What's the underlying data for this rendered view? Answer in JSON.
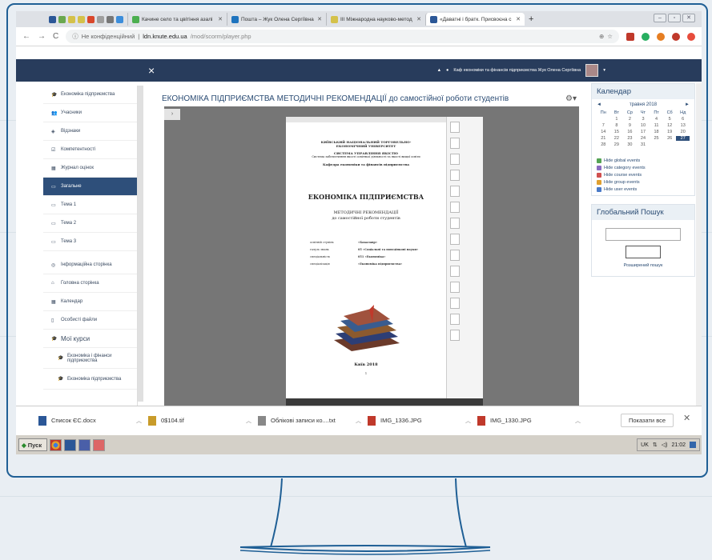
{
  "browser": {
    "tabs": [
      {
        "label": "Качине село та цвітіння азалі",
        "icon": "leaf-icon"
      },
      {
        "label": "Пошта – Жук Олена Сергіївна",
        "icon": "mail-icon"
      },
      {
        "label": "III Міжнародна науково-метод",
        "icon": "conference-icon"
      },
      {
        "label": "«Даватні і братк. Присвоєна с",
        "icon": "doc-icon"
      }
    ],
    "new_tab": "+",
    "address": {
      "secure_label": "Не конфіденційний",
      "host": "ldn.knute.edu.ua",
      "path": "/mod/scorm/player.php"
    }
  },
  "moodle": {
    "close": "×",
    "user_name": "Каф економіки та фінансів підприємства Жук Олена Сергіївна",
    "sidebar": [
      {
        "label": "Економіка підприємства",
        "icon": "cap-icon"
      },
      {
        "label": "Учасники",
        "icon": "users-icon"
      },
      {
        "label": "Відзнаки",
        "icon": "badge-icon"
      },
      {
        "label": "Компетентності",
        "icon": "check-icon"
      },
      {
        "label": "Журнал оцінок",
        "icon": "table-icon"
      },
      {
        "label": "Загальне",
        "icon": "folder-icon",
        "active": true
      },
      {
        "label": "Тема 1",
        "icon": "folder-icon"
      },
      {
        "label": "Тема 2",
        "icon": "folder-icon"
      },
      {
        "label": "Тема 3",
        "icon": "folder-icon"
      }
    ],
    "sidebar2": [
      {
        "label": "Інформаційна сторінка",
        "icon": "dashboard-icon"
      },
      {
        "label": "Головна сторінка",
        "icon": "home-icon"
      },
      {
        "label": "Календар",
        "icon": "calendar-icon"
      },
      {
        "label": "Особисті файли",
        "icon": "file-icon"
      },
      {
        "label": "Мої курси",
        "icon": "cap-icon",
        "big": true
      },
      {
        "label": "Економіка і фінанси підприємства",
        "icon": "cap-icon",
        "sub": true
      },
      {
        "label": "Економіка підприємства",
        "icon": "cap-icon",
        "sub": true
      }
    ],
    "content_title": "ЕКОНОМІКА ПІДПРИЄМСТВА МЕТОДИЧНІ РЕКОМЕНДАЦІЇ до самостійної роботи студентів",
    "toggle": "›"
  },
  "document": {
    "institution": "КИЇВСЬКИЙ НАЦІОНАЛЬНИЙ ТОРГОВЕЛЬНО-ЕКОНОМІЧНИЙ УНІВЕРСИТЕТ",
    "system": "СИСТЕМА УПРАВЛІННЯ ЯКІСТЮ",
    "system_sub": "Система забезпечення якості освітньої діяльності та якості вищої освіти",
    "department": "Кафедра економіки та фінансів підприємства",
    "title": "ЕКОНОМІКА ПІДПРИЄМСТВА",
    "subtitle1": "МЕТОДИЧНІ РЕКОМЕНДАЦІЇ",
    "subtitle2": "до самостійної роботи студентів",
    "meta": [
      {
        "k": "освітній ступінь",
        "v": "«Бакалавр»"
      },
      {
        "k": "галузь знань",
        "v": "05 «Соціальні та поведінкові науки»"
      },
      {
        "k": "спеціальність",
        "v": "051 «Економіка»"
      },
      {
        "k": "спеціалізація",
        "v": "«Економіка підприємства»"
      }
    ],
    "city_year": "Київ 2018",
    "page_num": "1"
  },
  "calendar": {
    "title": "Календар",
    "month": "травня 2018",
    "prev": "◄",
    "next": "►",
    "daynames": [
      "Пн",
      "Вт",
      "Ср",
      "Чт",
      "Пт",
      "Сб",
      "Нд"
    ],
    "days": [
      "",
      "1",
      "2",
      "3",
      "4",
      "5",
      "6",
      "7",
      "8",
      "9",
      "10",
      "11",
      "12",
      "13",
      "14",
      "15",
      "16",
      "17",
      "18",
      "19",
      "20",
      "21",
      "22",
      "23",
      "24",
      "25",
      "26",
      "27",
      "28",
      "29",
      "30",
      "31"
    ],
    "today": "27",
    "events": [
      {
        "label": "Hide global events",
        "color": "#55a455",
        "icon": "globe-icon"
      },
      {
        "label": "Hide category events",
        "color": "#8a6bc1",
        "icon": "category-icon"
      },
      {
        "label": "Hide course events",
        "color": "#d05050",
        "icon": "course-icon"
      },
      {
        "label": "Hide group events",
        "color": "#e0a030",
        "icon": "group-icon"
      },
      {
        "label": "Hide user events",
        "color": "#4a7ac8",
        "icon": "user-icon"
      }
    ]
  },
  "search": {
    "title": "Глобальний Пошук",
    "advanced": "Розширений пошук"
  },
  "downloads": {
    "items": [
      {
        "name": "Список ЄС.docx",
        "color": "#2b5797"
      },
      {
        "name": "0$104.tif",
        "color": "#c89b2a"
      },
      {
        "name": "Облікові записи ко....txt",
        "color": "#888888"
      },
      {
        "name": "IMG_1336.JPG",
        "color": "#c0392b"
      },
      {
        "name": "IMG_1330.JPG",
        "color": "#c0392b"
      }
    ],
    "show_all": "Показати все",
    "close": "✕"
  },
  "taskbar": {
    "start": "Пуск",
    "lang": "UK",
    "time": "21:02"
  }
}
